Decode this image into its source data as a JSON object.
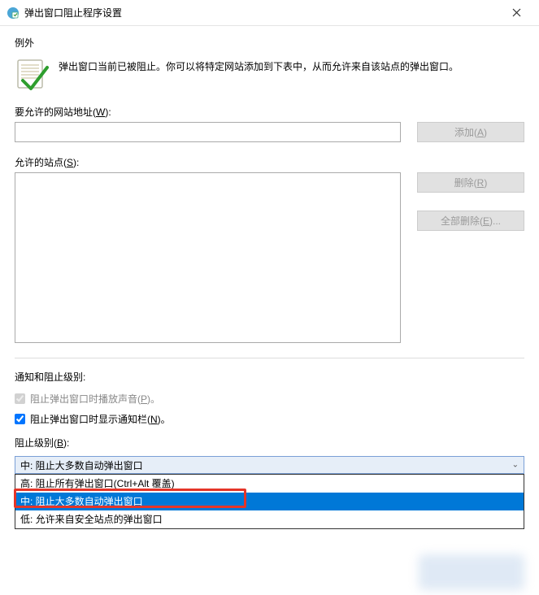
{
  "window": {
    "title": "弹出窗口阻止程序设置"
  },
  "exceptions": {
    "heading": "例外",
    "intro": "弹出窗口当前已被阻止。你可以将特定网站添加到下表中，从而允许来自该站点的弹出窗口。",
    "url_label_pre": "要允许的网站地址(",
    "url_accel": "W",
    "url_label_post": "):",
    "url_value": "",
    "add_btn_pre": "添加(",
    "add_accel": "A",
    "add_btn_post": ")",
    "sites_label_pre": "允许的站点(",
    "sites_accel": "S",
    "sites_label_post": "):",
    "remove_btn_pre": "删除(",
    "remove_accel": "R",
    "remove_btn_post": ")",
    "remove_all_btn_pre": "全部删除(",
    "remove_all_accel": "E",
    "remove_all_btn_post": ")..."
  },
  "notifications": {
    "heading": "通知和阻止级别:",
    "cb1_pre": "阻止弹出窗口时播放声音(",
    "cb1_accel": "P",
    "cb1_post": ")。",
    "cb1_checked": true,
    "cb1_disabled": true,
    "cb2_pre": "阻止弹出窗口时显示通知栏(",
    "cb2_accel": "N",
    "cb2_post": ")。",
    "cb2_checked": true,
    "level_label_pre": "阻止级别(",
    "level_accel": "B",
    "level_label_post": "):",
    "selected": "中: 阻止大多数自动弹出窗口",
    "options": {
      "high": "高: 阻止所有弹出窗口(Ctrl+Alt 覆盖)",
      "medium": "中: 阻止大多数自动弹出窗口",
      "low": "低: 允许来自安全站点的弹出窗口"
    }
  }
}
